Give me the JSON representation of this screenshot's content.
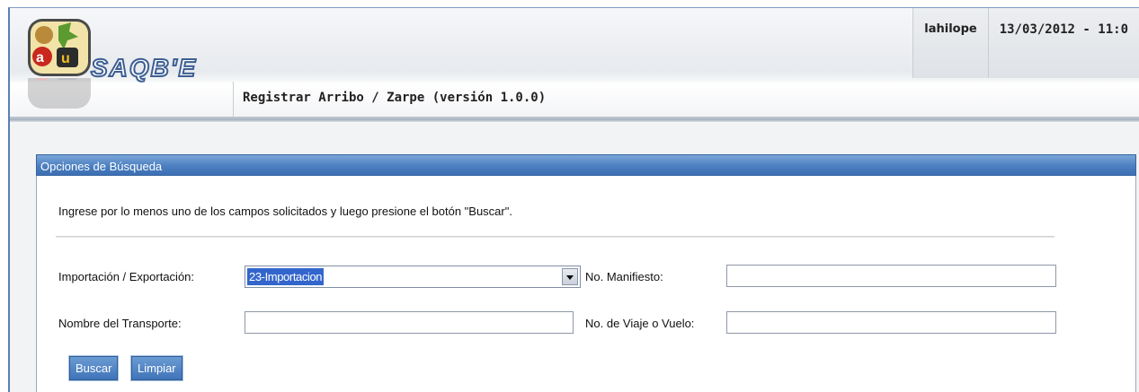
{
  "header": {
    "logo_text": "SAQB'E",
    "username": "lahilope",
    "datetime": "13/03/2012 - 11:0",
    "app_title": "Registrar Arribo / Zarpe (versión 1.0.0)"
  },
  "search_panel": {
    "title": "Opciones de Búsqueda",
    "instructions": "Ingrese por lo menos uno de los campos solicitados y luego presione el botón \"Buscar\".",
    "import_export": {
      "label": "Importación / Exportación:",
      "value": "23-Importacion"
    },
    "manifiesto": {
      "label": "No. Manifiesto:",
      "value": ""
    },
    "transporte": {
      "label": "Nombre del Transporte:",
      "value": ""
    },
    "viaje": {
      "label": "No. de Viaje o Vuelo:",
      "value": ""
    },
    "buttons": {
      "buscar": "Buscar",
      "limpiar": "Limpiar"
    }
  },
  "colors": {
    "panel_header": "#4c7fc0",
    "button": "#3f74b8",
    "selected_option": "#3366cc"
  }
}
